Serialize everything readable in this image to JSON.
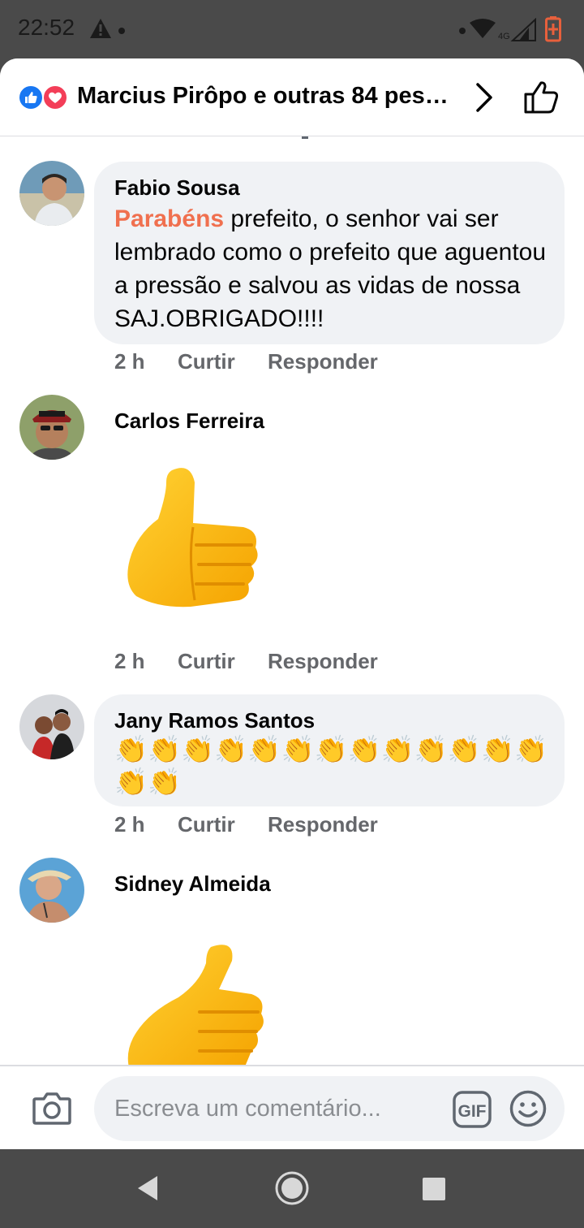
{
  "status_bar": {
    "time": "22:52",
    "network": "4G",
    "icons": [
      "warning-icon",
      "wifi-icon",
      "signal-icon",
      "battery-charging-icon"
    ]
  },
  "header": {
    "reaction_icons": [
      "like-reaction-icon",
      "love-reaction-icon"
    ],
    "reactions_text": "Marcius Pirôpo e outras 84 pes…",
    "accent_like": "#1877f2",
    "accent_love": "#f33e58"
  },
  "comments": [
    {
      "author": "Fabio Sousa",
      "highlight": "Parabéns",
      "text": " prefeito, o senhor vai ser lembrado como o prefeito que aguentou a pressão e salvou as vidas de nossa SAJ.OBRIGADO!!!!",
      "time": "2 h",
      "like_label": "Curtir",
      "reply_label": "Responder"
    },
    {
      "author": "Carlos Ferreira",
      "sticker": "thumbs-up-sticker",
      "time": "2 h",
      "like_label": "Curtir",
      "reply_label": "Responder"
    },
    {
      "author": "Jany Ramos Santos",
      "emoji_line1": "👏👏👏👏👏👏👏👏👏👏👏👏👏",
      "emoji_line2": "👏👏",
      "time": "2 h",
      "like_label": "Curtir",
      "reply_label": "Responder"
    },
    {
      "author": "Sidney Almeida",
      "sticker": "thumbs-up-sticker"
    }
  ],
  "composer": {
    "placeholder": "Escreva um comentário...",
    "gif_label": "GIF",
    "icons": [
      "camera-icon",
      "gif-icon",
      "emoji-icon"
    ]
  },
  "nav_bar": {
    "icons": [
      "back-icon",
      "home-icon",
      "recents-icon"
    ]
  },
  "colors": {
    "highlight": "#f0704f",
    "bubble": "#f0f2f5",
    "meta": "#65676b",
    "system_bar": "#4a4a4a"
  }
}
